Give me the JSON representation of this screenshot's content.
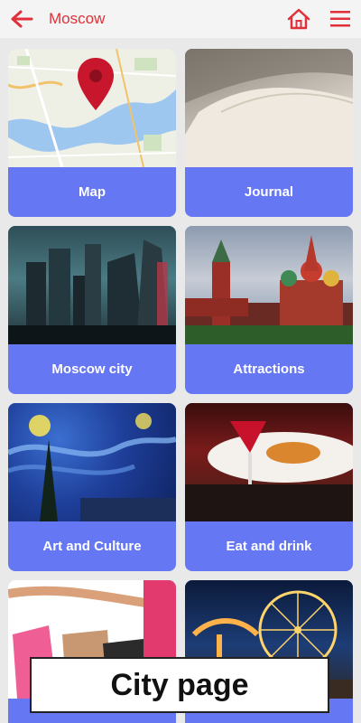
{
  "header": {
    "title": "Moscow",
    "back_icon": "back-arrow-icon",
    "home_icon": "home-icon",
    "menu_icon": "hamburger-menu-icon",
    "accent_color": "#e0303a"
  },
  "tiles": [
    {
      "label": "Map"
    },
    {
      "label": "Journal"
    },
    {
      "label": "Moscow city"
    },
    {
      "label": "Attractions"
    },
    {
      "label": "Art and Culture"
    },
    {
      "label": "Eat and drink"
    },
    {
      "label": ""
    },
    {
      "label": ""
    }
  ],
  "caption": {
    "text": "City page"
  },
  "colors": {
    "tile_label_bg": "#6677f4",
    "background": "#e9e9e9"
  }
}
